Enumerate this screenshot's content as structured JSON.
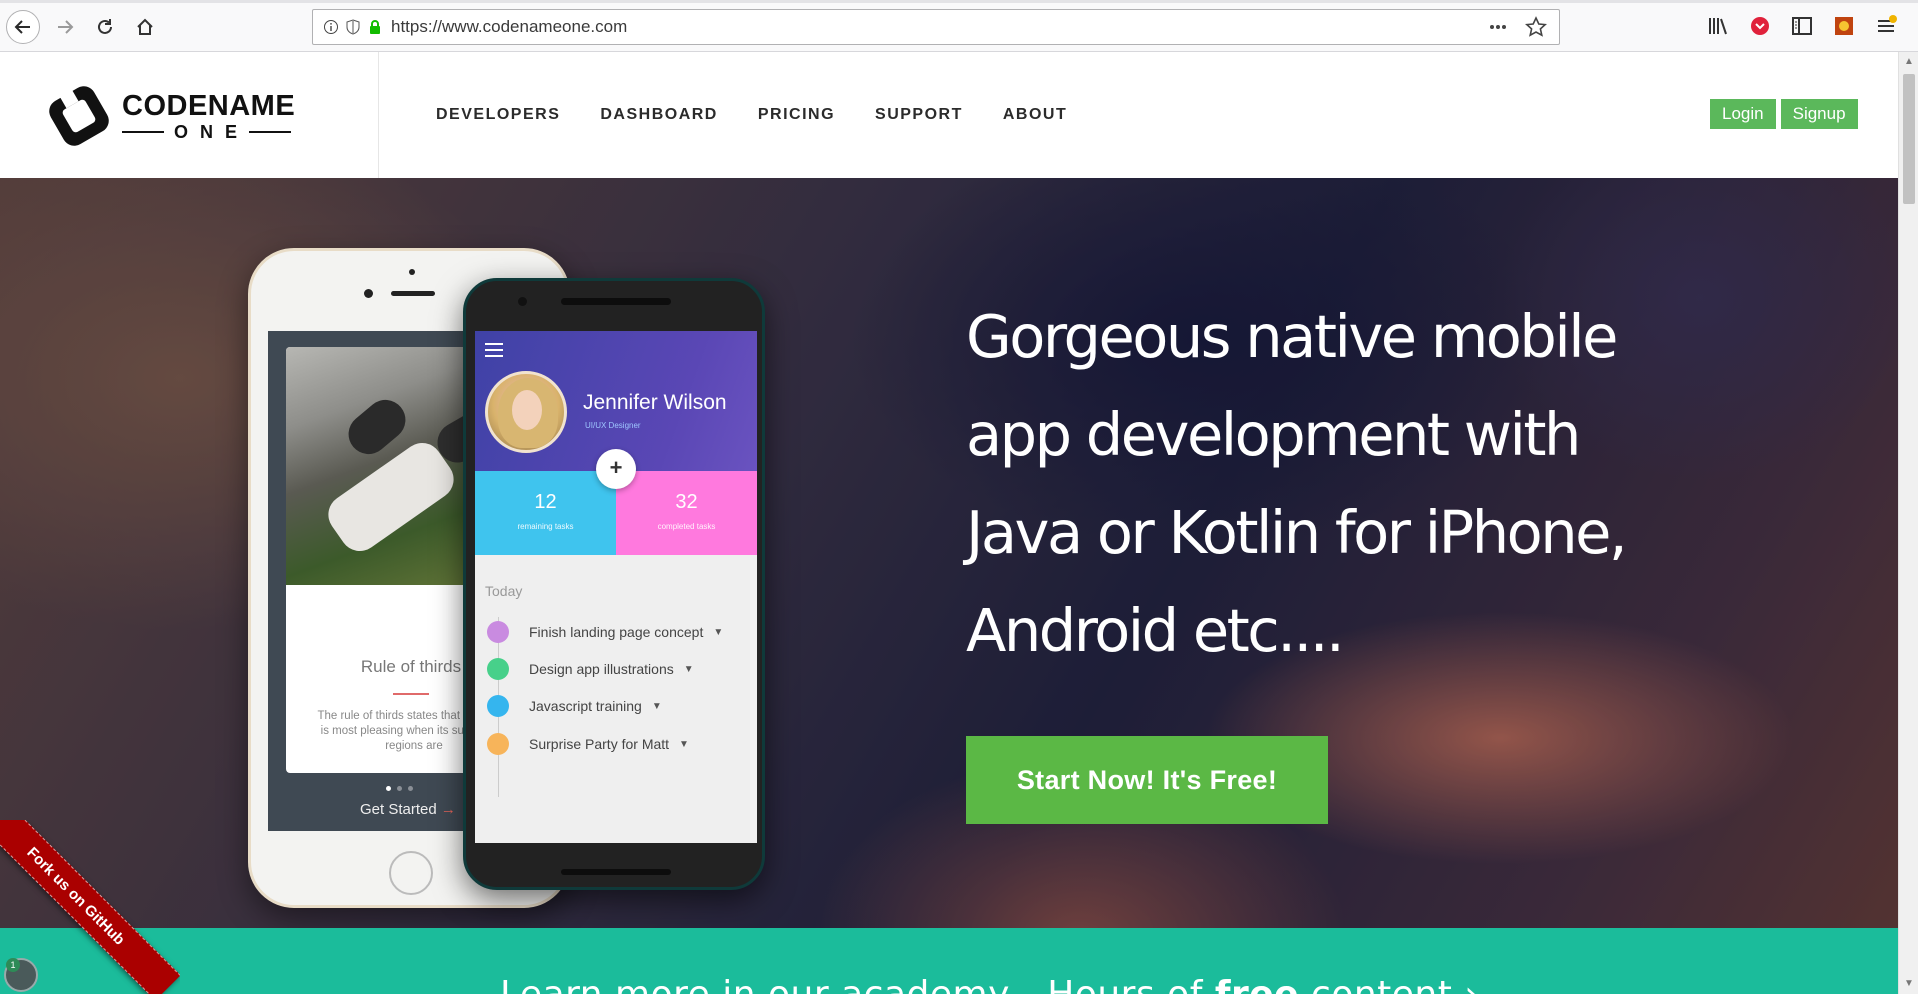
{
  "browser": {
    "url": "https://www.codenameone.com",
    "icons": {
      "back": "back-arrow-icon",
      "forward": "forward-arrow-icon",
      "reload": "reload-icon",
      "home": "home-icon",
      "info": "info-icon",
      "tracking": "shield-icon",
      "secure": "lock-icon",
      "page_actions": "more-dots-icon",
      "bookmark": "star-icon",
      "library": "library-icon",
      "pocket": "pocket-icon",
      "sidebar": "sidebar-icon",
      "extension": "extension-icon",
      "menu": "hamburger-menu-icon"
    }
  },
  "header": {
    "logo": {
      "line1": "CODENAME",
      "line2": "ONE"
    },
    "nav": [
      "DEVELOPERS",
      "DASHBOARD",
      "PRICING",
      "SUPPORT",
      "ABOUT"
    ],
    "login_label": "Login",
    "signup_label": "Signup"
  },
  "hero": {
    "headline": "Gorgeous native mobile app development with Java or Kotlin for iPhone, Android etc....",
    "cta_label": "Start Now! It's Free!",
    "iphone": {
      "card_title": "Rule of thirds",
      "card_body": "The rule of thirds states that an image is most pleasing when its subjects or regions are",
      "get_started": "Get Started"
    },
    "android": {
      "name": "Jennifer Wilson",
      "role": "UI/UX Designer",
      "stats": [
        {
          "value": "12",
          "label": "remaining tasks"
        },
        {
          "value": "32",
          "label": "completed tasks"
        }
      ],
      "fab": "+",
      "today_label": "Today",
      "tasks": [
        {
          "label": "Finish landing page concept",
          "color": "#c98be0"
        },
        {
          "label": "Design app illustrations",
          "color": "#47d08a"
        },
        {
          "label": "Javascript training",
          "color": "#35b5ee"
        },
        {
          "label": "Surprise Party for Matt",
          "color": "#f7b45a"
        }
      ]
    }
  },
  "band": {
    "text_before": "Learn more in our academy - Hours of ",
    "text_bold": "free",
    "text_after": " content ›"
  },
  "ribbon": {
    "label": "Fork us on GitHub"
  },
  "notification": {
    "count": "1"
  },
  "colors": {
    "accent_green": "#5bb85b",
    "cta_green": "#5bb845",
    "band_teal": "#1bbc9b",
    "ribbon_red": "#aa0000"
  }
}
